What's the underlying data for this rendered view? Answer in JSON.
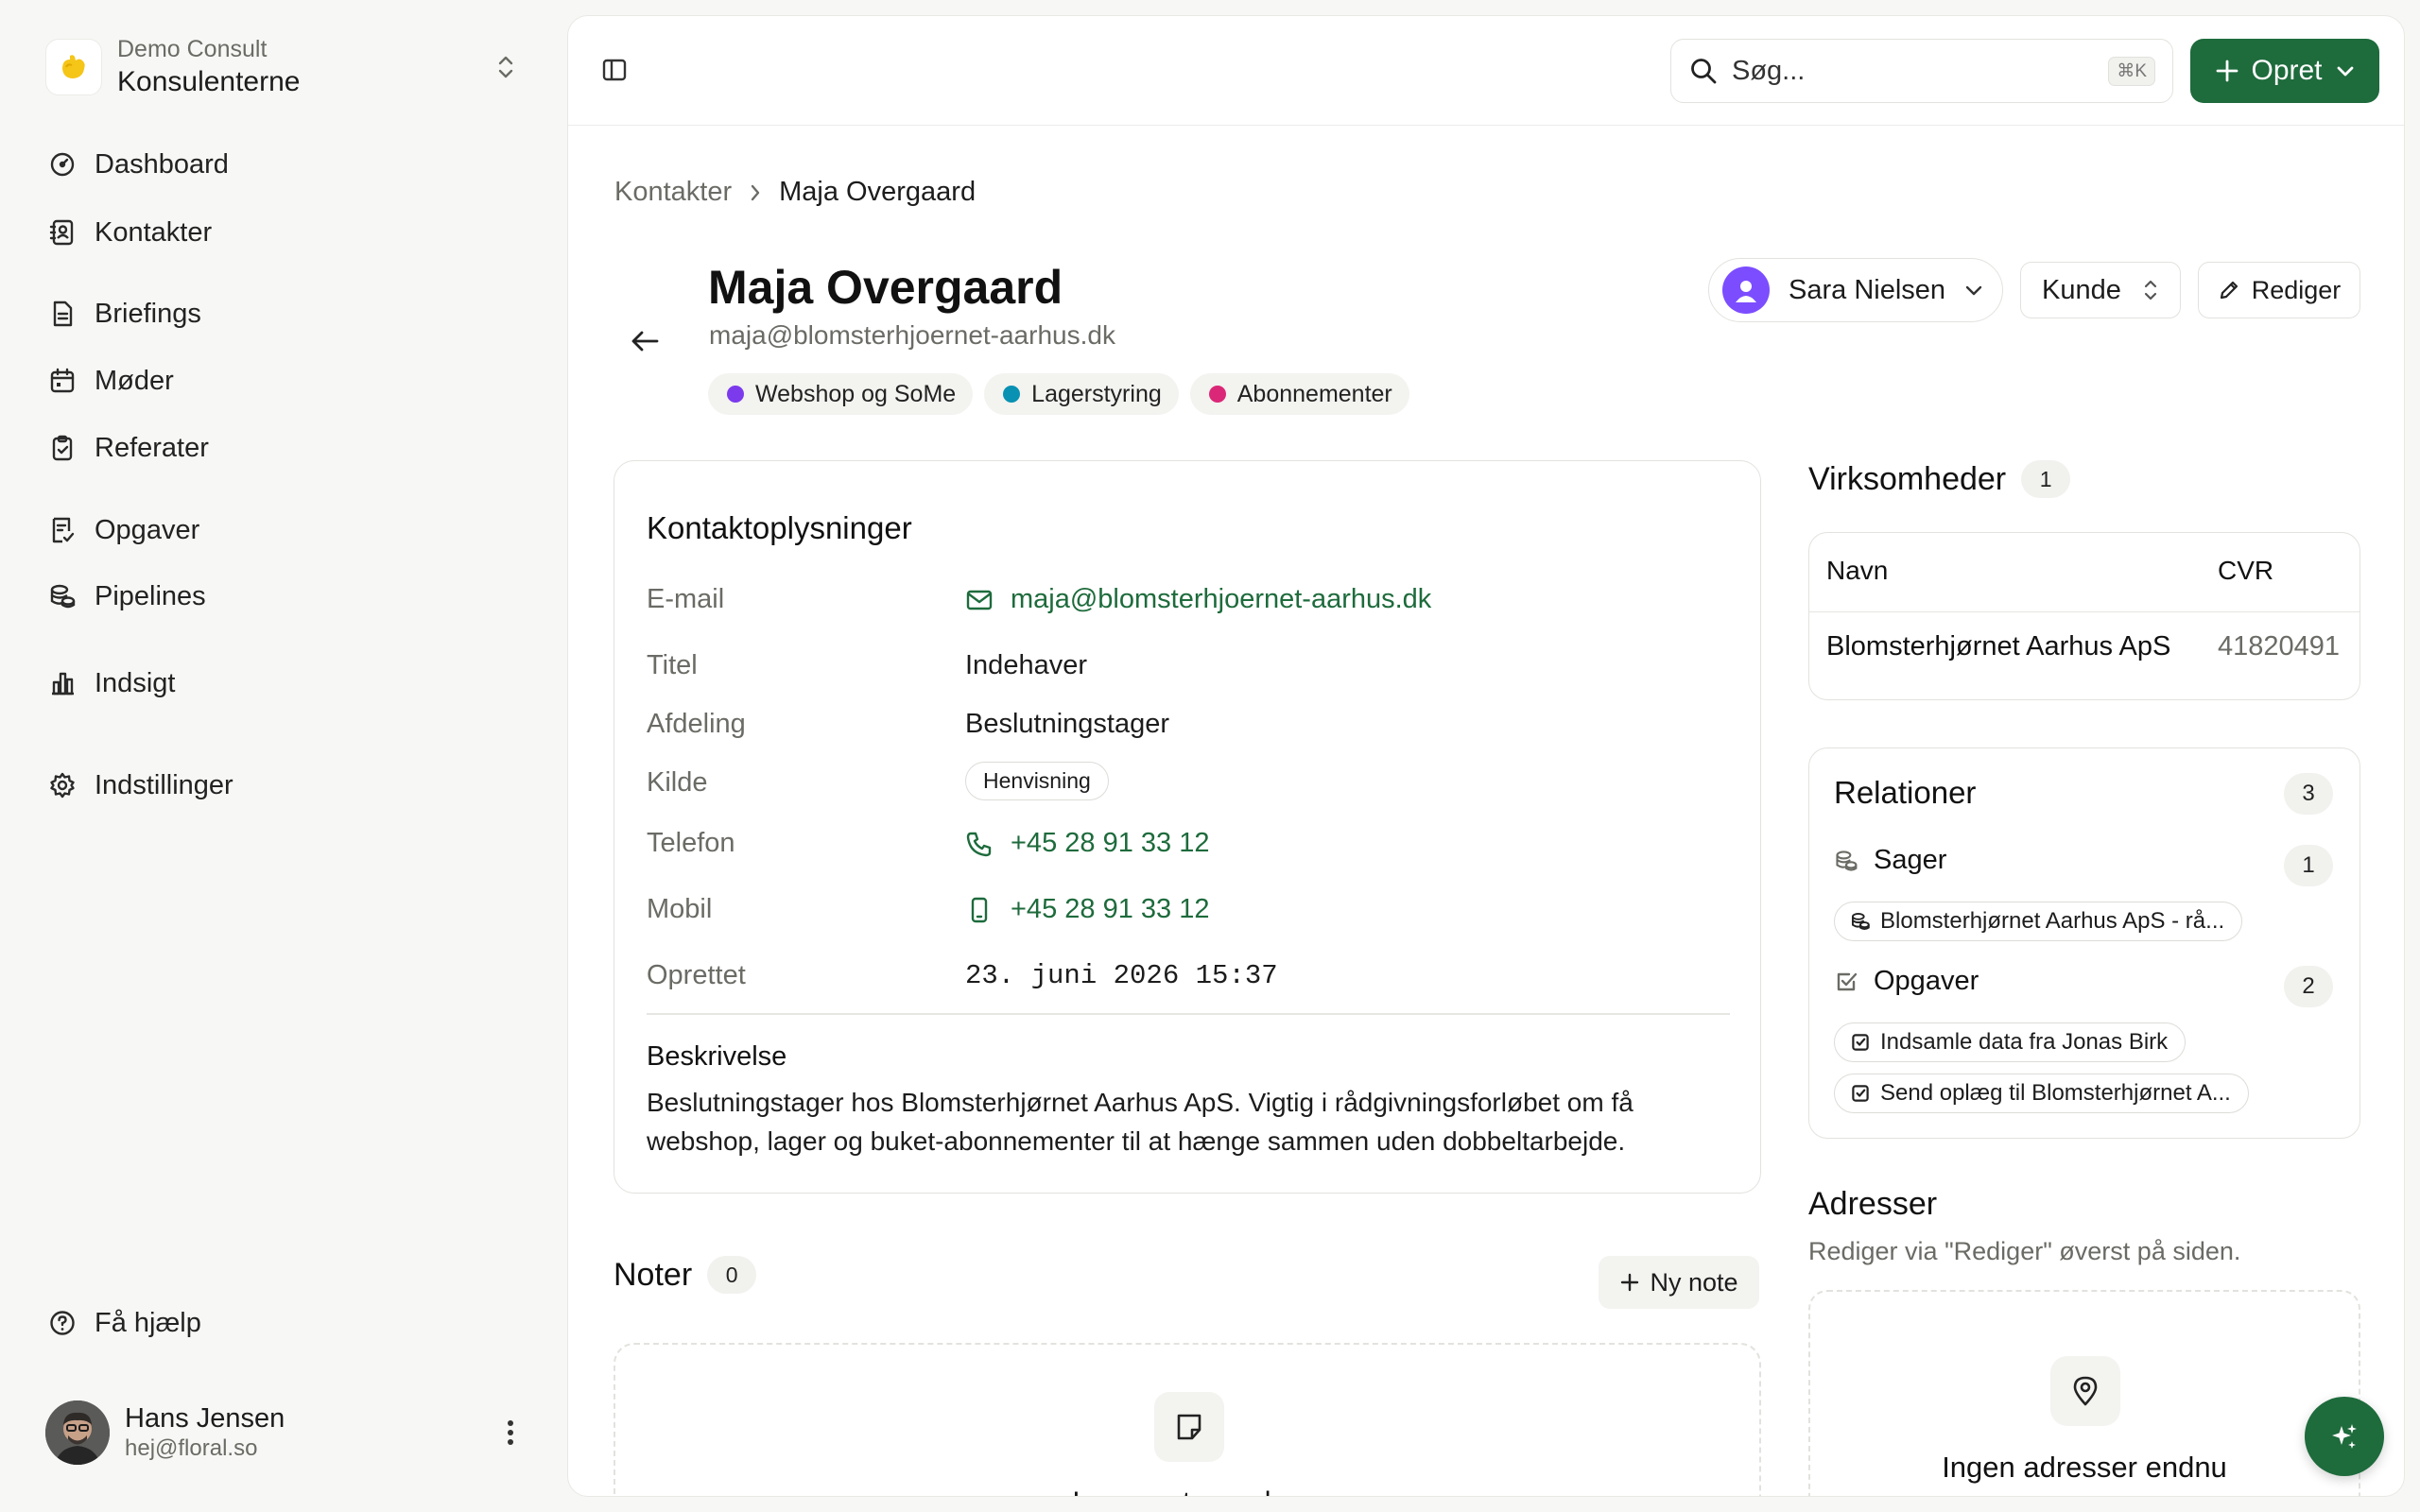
{
  "org": {
    "label": "Demo Consult",
    "name": "Konsulenterne"
  },
  "nav": {
    "dashboard": "Dashboard",
    "contacts": "Kontakter",
    "briefings": "Briefings",
    "meetings": "Møder",
    "minutes": "Referater",
    "tasks": "Opgaver",
    "pipelines": "Pipelines",
    "insights": "Indsigt",
    "settings": "Indstillinger",
    "help": "Få hjælp"
  },
  "user": {
    "name": "Hans Jensen",
    "email": "hej@floral.so"
  },
  "topbar": {
    "search_placeholder": "Søg...",
    "search_shortcut": "⌘K",
    "create_label": "Opret"
  },
  "breadcrumb": {
    "parent": "Kontakter",
    "current": "Maja Overgaard"
  },
  "contact": {
    "name": "Maja Overgaard",
    "email": "maja@blomsterhjoernet-aarhus.dk",
    "tags": [
      {
        "label": "Webshop og SoMe",
        "color": "#7c3aed"
      },
      {
        "label": "Lagerstyring",
        "color": "#0891b2"
      },
      {
        "label": "Abonnementer",
        "color": "#db2777"
      }
    ],
    "owner": "Sara Nielsen",
    "status": "Kunde",
    "edit_label": "Rediger"
  },
  "info": {
    "title": "Kontaktoplysninger",
    "email_label": "E-mail",
    "email_value": "maja@blomsterhjoernet-aarhus.dk",
    "title_label": "Titel",
    "title_value": "Indehaver",
    "department_label": "Afdeling",
    "department_value": "Beslutningstager",
    "source_label": "Kilde",
    "source_value": "Henvisning",
    "phone_label": "Telefon",
    "phone_value": "+45 28 91 33 12",
    "mobile_label": "Mobil",
    "mobile_value": "+45 28 91 33 12",
    "created_label": "Oprettet",
    "created_value": "23. juni 2026 15:37",
    "description_title": "Beskrivelse",
    "description": "Beslutningstager hos Blomsterhjørnet Aarhus ApS. Vigtig i rådgivningsforløbet om få webshop, lager og buket-abonnementer til at hænge sammen uden dobbeltarbejde."
  },
  "notes": {
    "title": "Noter",
    "count": "0",
    "new_label": "Ny note",
    "empty_text": "Ingen noter endnu"
  },
  "companies": {
    "title": "Virksomheder",
    "count": "1",
    "col_name": "Navn",
    "col_cvr": "CVR",
    "rows": [
      {
        "name": "Blomsterhjørnet Aarhus ApS",
        "cvr": "41820491"
      }
    ]
  },
  "relations": {
    "title": "Relationer",
    "count": "3",
    "cases_label": "Sager",
    "cases_count": "1",
    "cases": [
      "Blomsterhjørnet Aarhus ApS - rå..."
    ],
    "tasks_label": "Opgaver",
    "tasks_count": "2",
    "tasks": [
      "Indsamle data fra Jonas Birk",
      "Send oplæg til Blomsterhjørnet A..."
    ]
  },
  "addresses": {
    "title": "Adresser",
    "subtitle": "Rediger via \"Rediger\" øverst på siden.",
    "empty_text": "Ingen adresser endnu"
  },
  "colors": {
    "accent": "#1e6b3c",
    "owner_avatar": "#7c4dff"
  },
  "icons": {
    "nav": [
      "dashboard-icon",
      "contacts-icon",
      "briefings-icon",
      "meetings-icon",
      "minutes-icon",
      "tasks-icon",
      "pipelines-icon",
      "insights-icon",
      "settings-icon",
      "help-icon"
    ]
  }
}
